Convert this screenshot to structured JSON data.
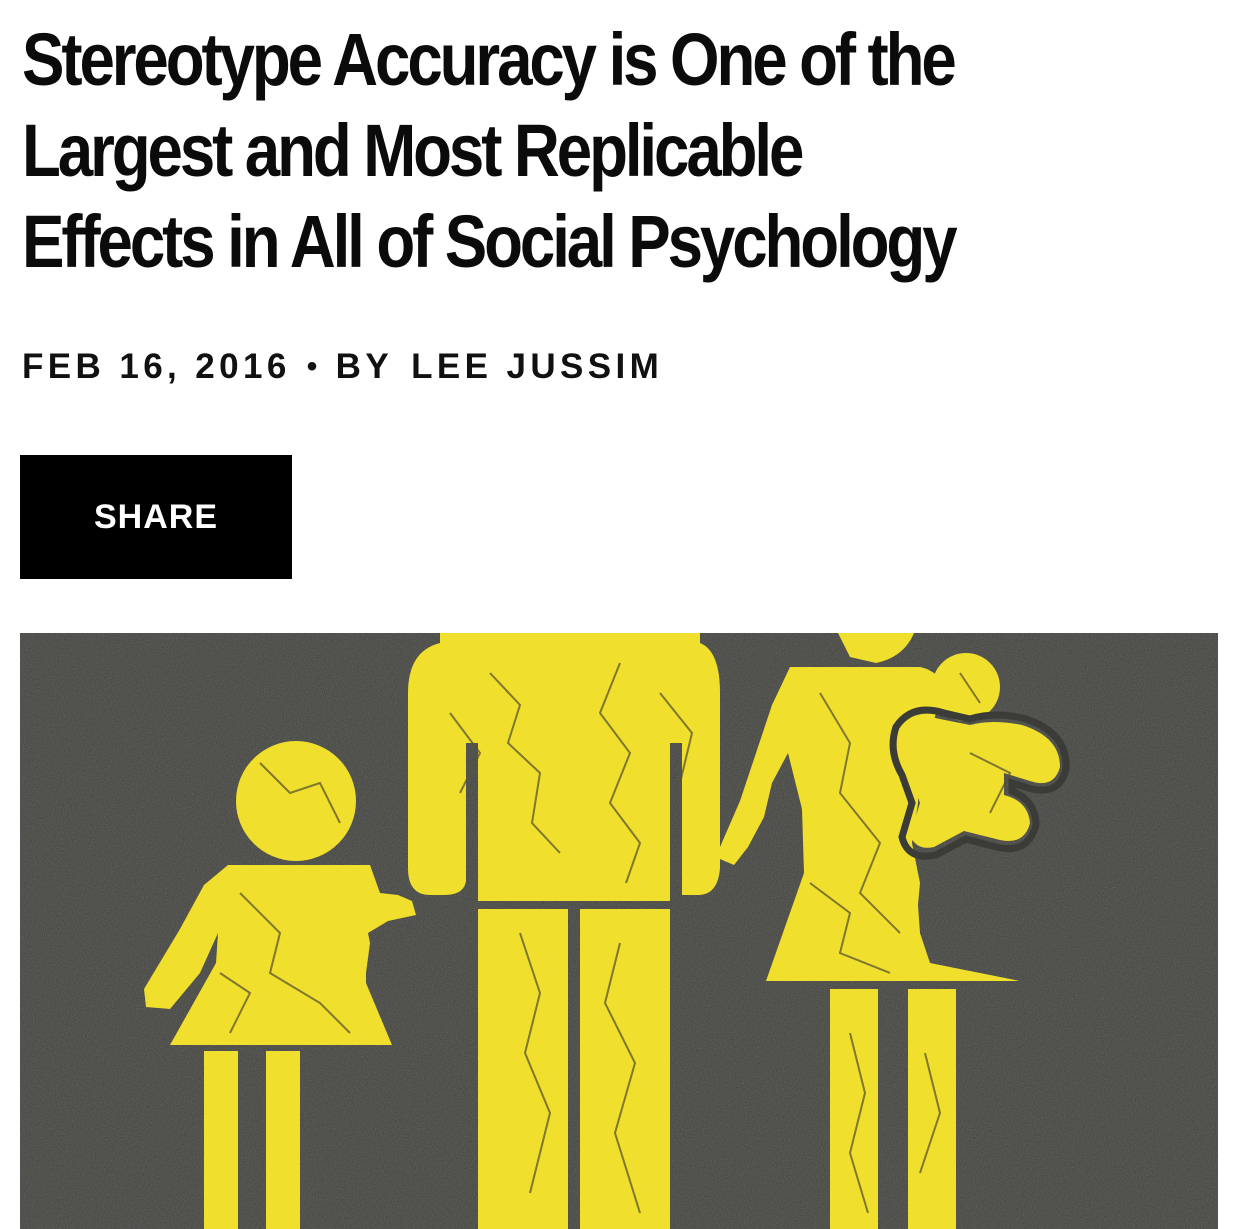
{
  "article": {
    "title_lines": [
      "Stereotype Accuracy is One of the",
      "Largest and Most Replicable",
      "Effects in All of Social Psychology"
    ],
    "date": "FEB 16, 2016",
    "separator": "•",
    "by_label": "BY",
    "author": "LEE JUSSIM",
    "share_label": "SHARE"
  },
  "image": {
    "description_icon": "family-road-marking-icon",
    "paint_color": "#f2e12a",
    "asphalt_color": "#3e3e3b"
  }
}
